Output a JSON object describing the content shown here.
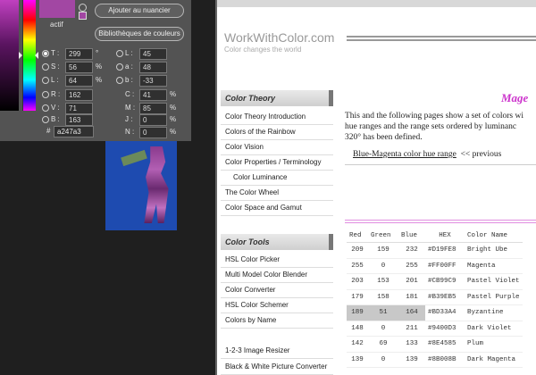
{
  "picker": {
    "new_color_hex": "#a247a3",
    "new_label": "actif",
    "buttons": {
      "add_swatch": "Ajouter au nuancier",
      "color_libraries": "Bibliothèques de couleurs"
    },
    "hsb": [
      {
        "label": "T :",
        "value": "299",
        "unit": "°",
        "selected": true
      },
      {
        "label": "S :",
        "value": "56",
        "unit": "%",
        "selected": false
      },
      {
        "label": "L :",
        "value": "64",
        "unit": "%",
        "selected": false
      }
    ],
    "rgb": [
      {
        "label": "R :",
        "value": "162"
      },
      {
        "label": "V :",
        "value": "71"
      },
      {
        "label": "B :",
        "value": "163"
      }
    ],
    "lab": [
      {
        "label": "L :",
        "value": "45",
        "unit": ""
      },
      {
        "label": "a :",
        "value": "48",
        "unit": ""
      },
      {
        "label": "b :",
        "value": "-33",
        "unit": ""
      }
    ],
    "cmyk": [
      {
        "label": "C :",
        "value": "41",
        "unit": "%"
      },
      {
        "label": "M :",
        "value": "85",
        "unit": "%"
      },
      {
        "label": "J :",
        "value": "0",
        "unit": "%"
      },
      {
        "label": "N :",
        "value": "0",
        "unit": "%"
      }
    ],
    "hex_hash": "#",
    "hex": "a247a3"
  },
  "site": {
    "logo": "WorkWithColor.com",
    "tagline": "Color changes the world",
    "title": "Mage",
    "intro_lines": [
      "This and the following pages show a set of colors wi",
      "hue ranges and the range sets ordered by luminanc",
      "320° has been defined."
    ],
    "nav": {
      "link": "Blue-Magenta color hue range",
      "prev": "<< previous"
    },
    "sidebar": {
      "theory_header": "Color Theory",
      "theory_items": [
        "Color Theory Introduction",
        "Colors of the Rainbow",
        "Color Vision",
        "Color Properties / Terminology",
        "Color Luminance",
        "The Color Wheel",
        "Color Space and Gamut"
      ],
      "tools_header": "Color Tools",
      "tools_items": [
        "HSL Color Picker",
        "Multi Model Color Blender",
        "Color Converter",
        "HSL Color Schemer",
        "Colors by Name"
      ],
      "extra_items": [
        "1-2-3 Image Resizer",
        "Black & White Picture Converter"
      ]
    },
    "table": {
      "headers": [
        "Red",
        "Green",
        "Blue",
        "HEX",
        "Color Name"
      ],
      "rows": [
        [
          "209",
          "159",
          "232",
          "#D19FE8",
          "Bright Ube"
        ],
        [
          "255",
          "0",
          "255",
          "#FF00FF",
          "Magenta"
        ],
        [
          "203",
          "153",
          "201",
          "#CB99C9",
          "Pastel Violet"
        ],
        [
          "179",
          "158",
          "181",
          "#B39EB5",
          "Pastel Purple"
        ],
        [
          "189",
          "51",
          "164",
          "#BD33A4",
          "Byzantine"
        ],
        [
          "148",
          "0",
          "211",
          "#9400D3",
          "Dark Violet"
        ],
        [
          "142",
          "69",
          "133",
          "#8E4585",
          "Plum"
        ],
        [
          "139",
          "0",
          "139",
          "#8B008B",
          "Dark Magenta"
        ]
      ]
    }
  }
}
